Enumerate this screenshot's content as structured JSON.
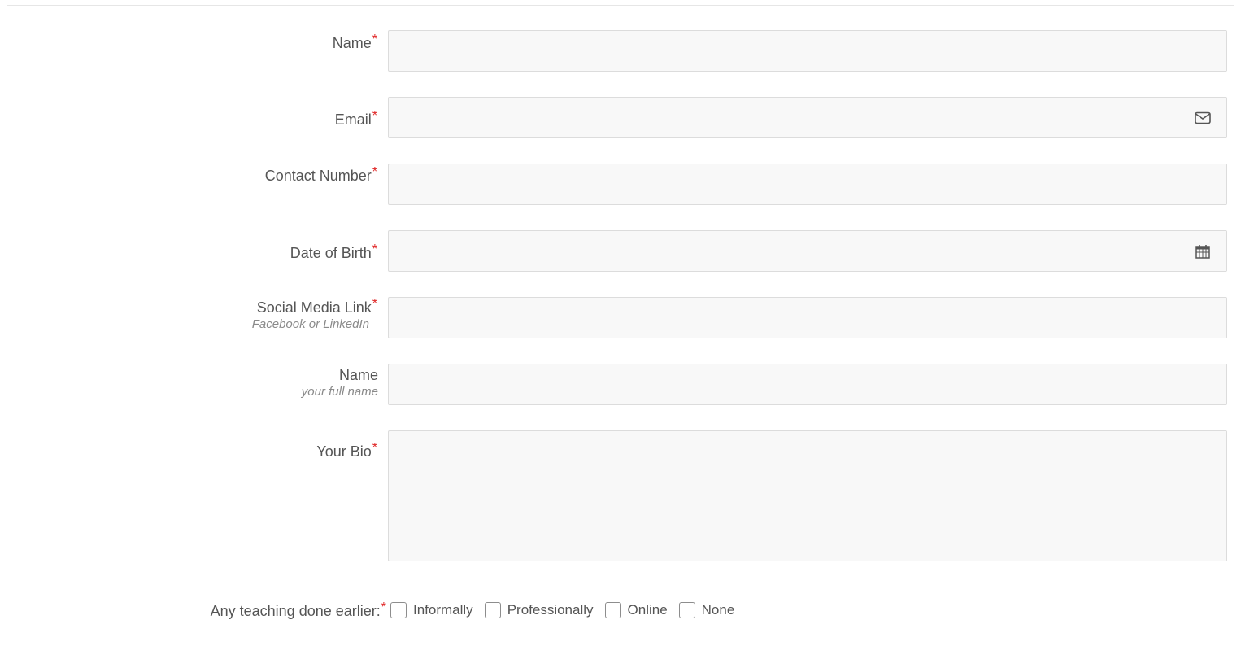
{
  "required_marker": "*",
  "fields": {
    "name": {
      "label": "Name",
      "value": "",
      "placeholder": ""
    },
    "email": {
      "label": "Email",
      "value": "",
      "placeholder": ""
    },
    "contact": {
      "label": "Contact Number",
      "value": "",
      "placeholder": ""
    },
    "dob": {
      "label": "Date of Birth",
      "value": "",
      "placeholder": ""
    },
    "social": {
      "label": "Social Media Link",
      "hint": "Facebook or LinkedIn",
      "value": "",
      "placeholder": ""
    },
    "fullname": {
      "label": "Name",
      "hint": "your full name",
      "value": "",
      "placeholder": ""
    },
    "bio": {
      "label": "Your Bio",
      "value": "",
      "placeholder": ""
    }
  },
  "teaching": {
    "label": "Any teaching done earlier:",
    "options": [
      "Informally",
      "Professionally",
      "Online",
      "None"
    ]
  },
  "icons": {
    "email": "envelope-icon",
    "dob": "calendar-icon"
  },
  "colors": {
    "required": "#e02424",
    "field_bg": "#f8f8f8",
    "field_border": "#dcdcdc"
  }
}
